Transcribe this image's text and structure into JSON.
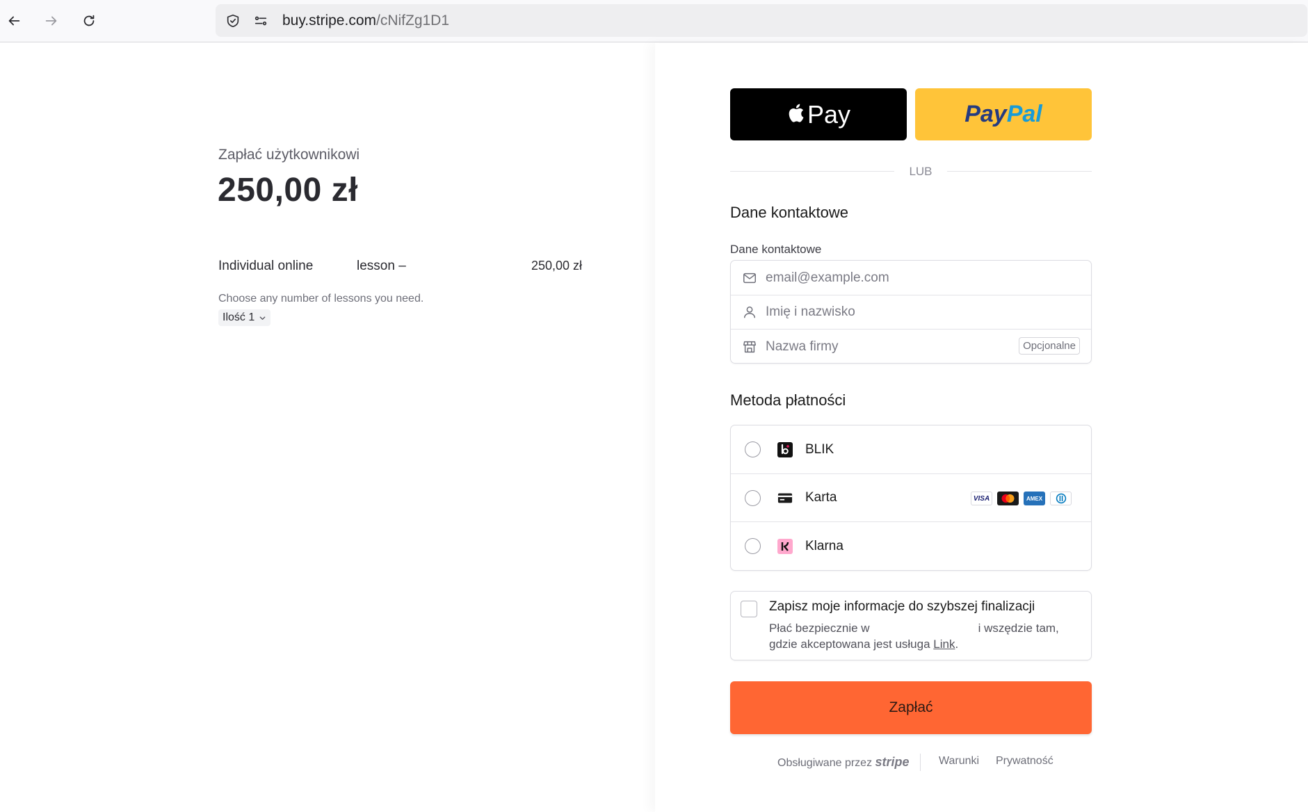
{
  "browser": {
    "url_host": "buy.stripe.com",
    "url_path": "/cNifZg1D1",
    "icons": [
      "back-arrow-icon",
      "forward-arrow-icon",
      "reload-icon",
      "shield-icon",
      "permissions-icon"
    ]
  },
  "summary": {
    "pay_to_label": "Zapłać użytkownikowi",
    "total": "250,00 zł",
    "item_name_part1": "Individual online",
    "item_name_part2": "lesson –",
    "item_price": "250,00 zł",
    "item_description": "Choose any number of lessons you need.",
    "quantity_label": "Ilość 1"
  },
  "wallets": {
    "apple_pay": "Pay",
    "paypal_part1": "Pay",
    "paypal_part2": "Pal",
    "divider": "LUB"
  },
  "contact": {
    "section_title": "Dane kontaktowe",
    "field_label": "Dane kontaktowe",
    "email_placeholder": "email@example.com",
    "name_placeholder": "Imię i nazwisko",
    "company_placeholder": "Nazwa firmy",
    "optional_badge": "Opcjonalne"
  },
  "payment": {
    "section_title": "Metoda płatności",
    "methods": [
      {
        "label": "BLIK",
        "icon": "blik-icon"
      },
      {
        "label": "Karta",
        "icon": "card-icon"
      },
      {
        "label": "Klarna",
        "icon": "klarna-icon"
      }
    ],
    "card_brands": [
      "VISA",
      "mastercard",
      "AMEX",
      "diners"
    ]
  },
  "save_info": {
    "title": "Zapisz moje informacje do szybszej finalizacji",
    "desc_part1": "Płać bezpiecznie w",
    "desc_part2": "i wszędzie tam, gdzie akceptowana jest usługa",
    "link": "Link",
    "period": "."
  },
  "pay_button": "Zapłać",
  "footer": {
    "powered_by": "Obsługiwane przez",
    "stripe": "stripe",
    "terms": "Warunki",
    "privacy": "Prywatność"
  },
  "colors": {
    "pay_button": "#ff6633",
    "paypal": "#ffc439",
    "apple_pay": "#000000"
  }
}
